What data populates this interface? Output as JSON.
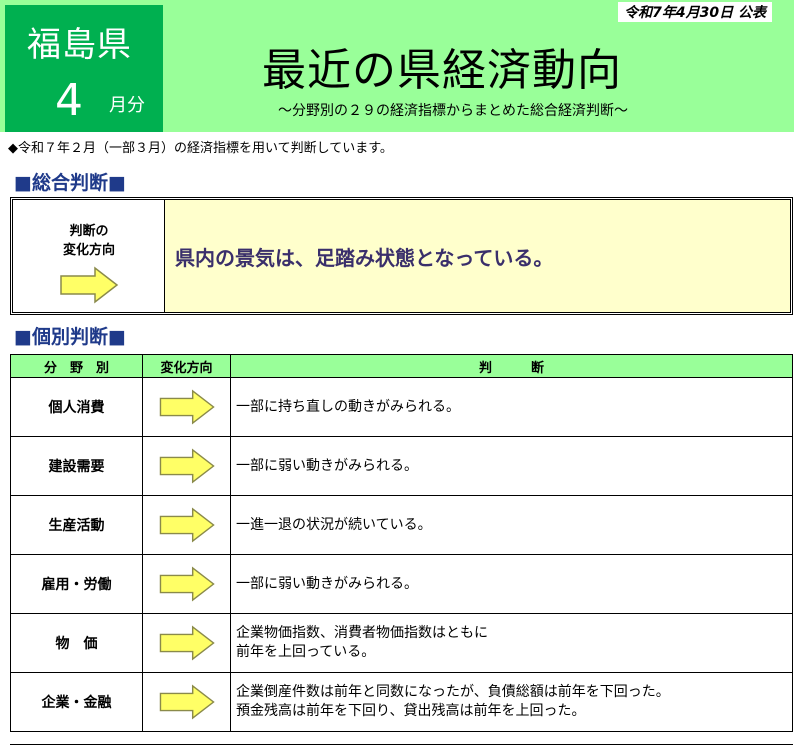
{
  "header": {
    "prefecture": "福島県",
    "month_number": "4",
    "month_suffix": "月分",
    "published": "令和7年4月30日 公表",
    "title": "最近の県経済動向",
    "subtitle": "～分野別の２９の経済指標からまとめた総合経済判断～"
  },
  "note": "◆令和７年２月（一部３月）の経済指標を用いて判断しています。",
  "overall": {
    "section_title": "■総合判断■",
    "direction_label_line1": "判断の",
    "direction_label_line2": "変化方向",
    "direction_icon": "right-arrow-icon",
    "judgment": "県内の景気は、足踏み状態となっている。"
  },
  "individual": {
    "section_title": "■個別判断■",
    "headers": [
      "分　野　別",
      "変化方向",
      "判　　　断"
    ],
    "rows": [
      {
        "category": "個人消費",
        "direction": "right-arrow-icon",
        "line1": "一部に持ち直しの動きがみられる。",
        "line2": ""
      },
      {
        "category": "建設需要",
        "direction": "right-arrow-icon",
        "line1": "一部に弱い動きがみられる。",
        "line2": ""
      },
      {
        "category": "生産活動",
        "direction": "right-arrow-icon",
        "line1": "一進一退の状況が続いている。",
        "line2": ""
      },
      {
        "category": "雇用・労働",
        "direction": "right-arrow-icon",
        "line1": "一部に弱い動きがみられる。",
        "line2": ""
      },
      {
        "category": "物　価",
        "direction": "right-arrow-icon",
        "line1": "企業物価指数、消費者物価指数はともに",
        "line2": "前年を上回っている。"
      },
      {
        "category": "企業・金融",
        "direction": "right-arrow-icon",
        "line1": "企業倒産件数は前年と同数になったが、負債総額は前年を下回った。",
        "line2": "預金残高は前年を下回り、貸出残高は前年を上回った。"
      }
    ]
  },
  "colors": {
    "header_bg": "#99ff99",
    "prefecture_bg": "#00b050",
    "section_title": "#1f3a8a",
    "judgment_bg": "#ffffcc",
    "arrow_fill": "#ffff66"
  }
}
